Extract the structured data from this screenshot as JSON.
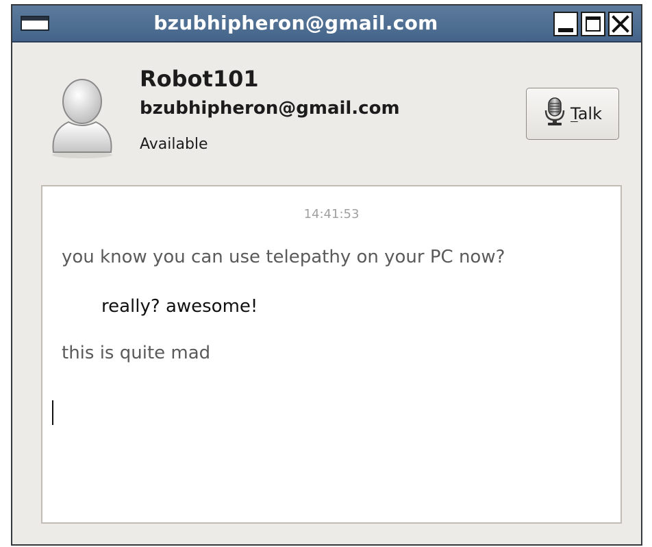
{
  "window": {
    "title": "bzubhipheron@gmail.com"
  },
  "contact": {
    "name": "Robot101",
    "email": "bzubhipheron@gmail.com",
    "status": "Available"
  },
  "actions": {
    "talk_label": "Talk",
    "talk_mnemonic": "T"
  },
  "chat": {
    "timestamp": "14:41:53",
    "messages": [
      {
        "text": "you know you can use telepathy on your PC now?",
        "direction": "incoming"
      },
      {
        "text": "really? awesome!",
        "direction": "outgoing"
      },
      {
        "text": "this is quite mad",
        "direction": "incoming"
      }
    ],
    "input_value": ""
  },
  "icons": {
    "window_menu": "window-menu-icon",
    "minimize": "minimize-icon",
    "maximize": "maximize-icon",
    "close": "close-icon",
    "avatar": "avatar-placeholder-icon",
    "talk": "microphone-icon"
  },
  "colors": {
    "titlebar": "#4f6f93",
    "window_bg": "#edebe7",
    "chat_bg": "#ffffff",
    "incoming_text": "#5a5a5a",
    "outgoing_text": "#111111",
    "timestamp_text": "#a0a0a0"
  }
}
